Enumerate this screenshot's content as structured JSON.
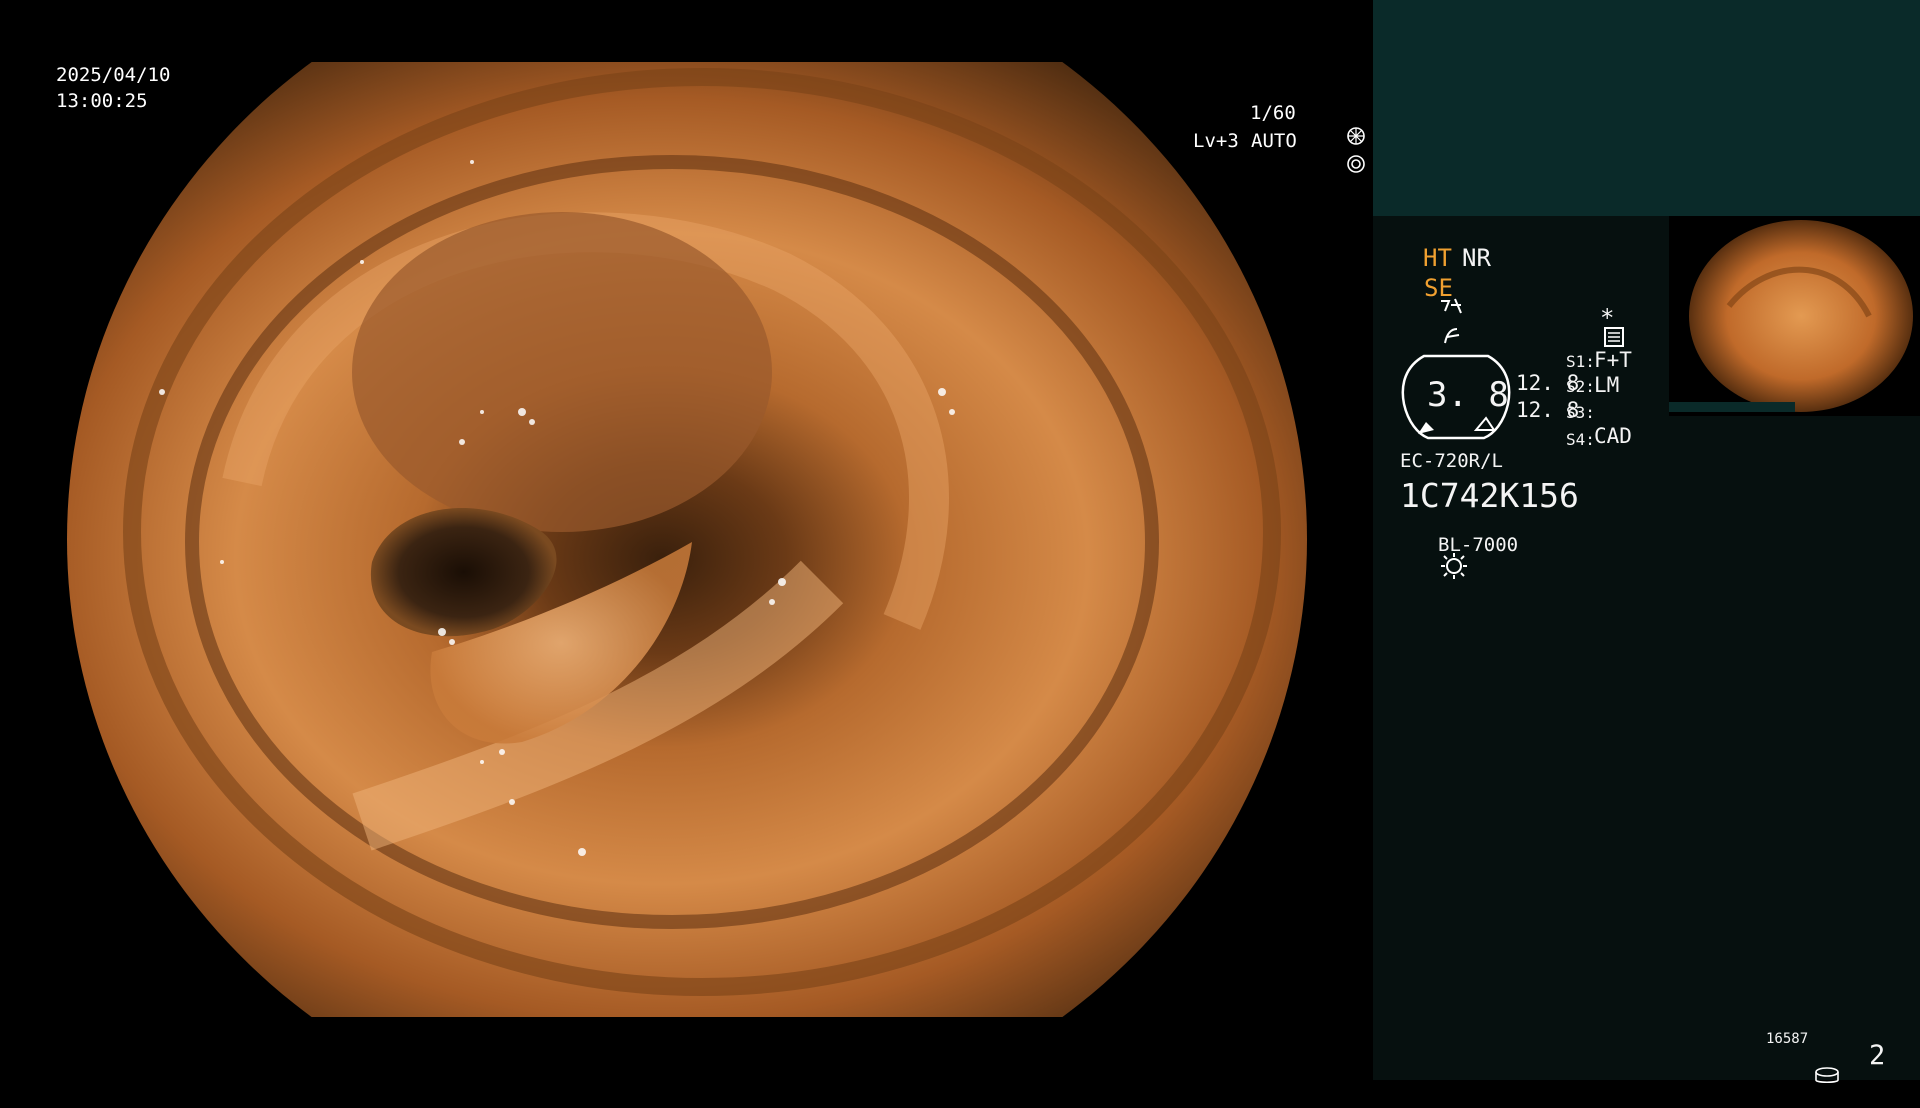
{
  "osd": {
    "date": "2025/04/10",
    "time": "13:00:25",
    "shutter": "1/60",
    "level": "Lv+3",
    "auto": "AUTO"
  },
  "panel": {
    "ht": "HT",
    "nr": "NR",
    "se": "SE",
    "settings_asterisk": "*",
    "gauge_value": "3. 8",
    "val1": "12. 8",
    "val2": "12. 8",
    "s1_label": "S1:",
    "s1_value": "F+T",
    "s2_label": "S2:",
    "s2_value": "LM",
    "s3_label": "S3:",
    "s3_value": "",
    "s4_label": "S4:",
    "s4_value": "CAD",
    "scope_model": "EC-720R/L",
    "serial": "1C742K156",
    "light_source": "BL-7000",
    "counter": "16587",
    "page": "2"
  },
  "colors": {
    "accent_orange": "#f0a030",
    "panel_bg": "#06100f",
    "panel_top": "#0a2a29"
  }
}
